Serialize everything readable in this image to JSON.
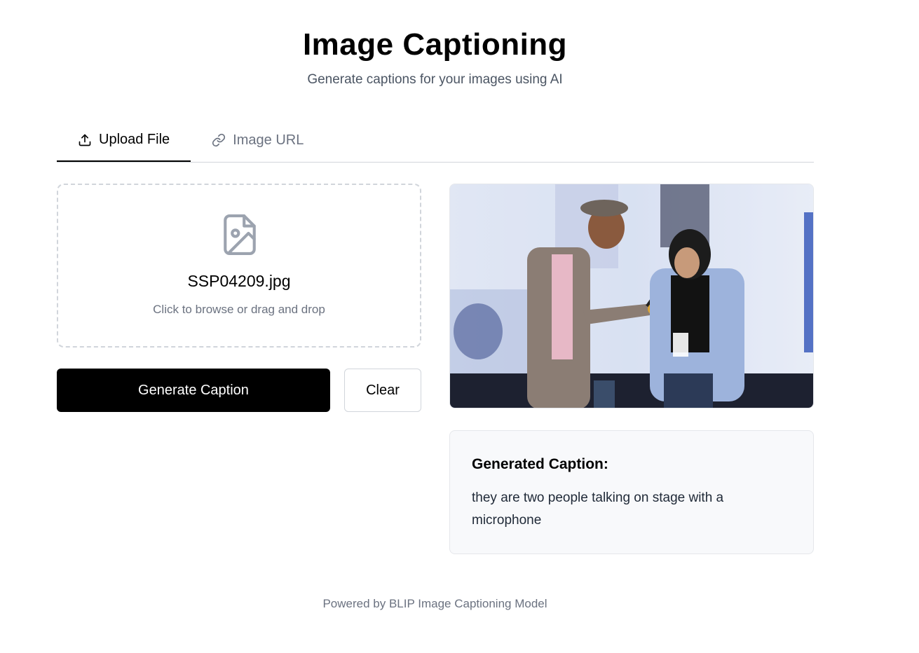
{
  "header": {
    "title": "Image Captioning",
    "subtitle": "Generate captions for your images using AI"
  },
  "tabs": [
    {
      "label": "Upload File",
      "icon": "upload-icon",
      "active": true
    },
    {
      "label": "Image URL",
      "icon": "link-icon",
      "active": false
    }
  ],
  "upload": {
    "file_name": "SSP04209.jpg",
    "hint": "Click to browse or drag and drop",
    "icon": "file-image-icon"
  },
  "actions": {
    "generate_label": "Generate Caption",
    "clear_label": "Clear"
  },
  "preview": {
    "icon": "image-preview"
  },
  "caption": {
    "heading": "Generated Caption:",
    "text": "they are two people talking on stage with a microphone"
  },
  "footer": {
    "text": "Powered by BLIP Image Captioning Model"
  },
  "colors": {
    "primary": "#000000",
    "muted_text": "#6b7280",
    "border": "#d1d5db",
    "caption_bg": "#f8f9fb"
  }
}
